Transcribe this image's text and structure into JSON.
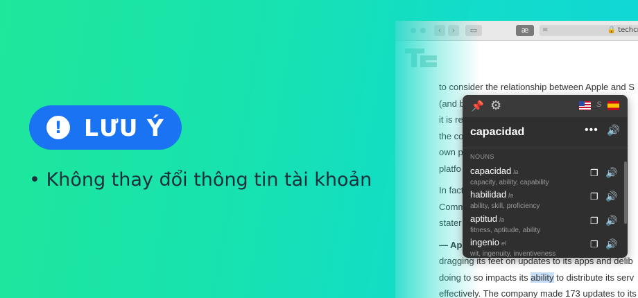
{
  "banner": {
    "badge_icon": "exclamation-icon",
    "badge_icon_glyph": "!",
    "badge_label": "LƯU Ý",
    "note": "• Không thay đổi thông tin tài khoản",
    "colors": {
      "badge": "#1a73f2",
      "bg_start": "#1fe79a",
      "bg_end": "#10d6d6"
    }
  },
  "browser": {
    "back_icon": "chevron-left-icon",
    "forward_icon": "chevron-right-icon",
    "sidebar_icon": "sidebar-icon",
    "ext_label": "æ",
    "reader_icon": "reader-icon",
    "url": "🔒 techcru",
    "article_lines": [
      "to consider the relationship between Apple and S",
      "(and b",
      "it is re",
      "the co",
      "own p",
      "platfo",
      "In fact",
      "Comm",
      "stater",
      "— Ap",
      "dragging its feet on updates to its apps and delib",
      "doing to so impacts its",
      "ability",
      "to distribute its serv",
      "effectively. The company made 173 updates to its"
    ]
  },
  "popup": {
    "pin_icon": "pin-icon",
    "gear_icon": "gear-icon",
    "source_flag": "us-flag-icon",
    "target_flag": "spain-flag-icon",
    "swap_label": "S",
    "word": "capacidad",
    "more_label": "•••",
    "section": "NOUNS",
    "entries": [
      {
        "word": "capacidad",
        "gender": "la",
        "synonyms": "capacity, ability, capability"
      },
      {
        "word": "habilidad",
        "gender": "la",
        "synonyms": "ability, skill, proficiency"
      },
      {
        "word": "aptitud",
        "gender": "la",
        "synonyms": "fitness, aptitude, ability"
      },
      {
        "word": "ingenio",
        "gender": "el",
        "synonyms": "wit, ingenuity, inventiveness"
      }
    ]
  }
}
